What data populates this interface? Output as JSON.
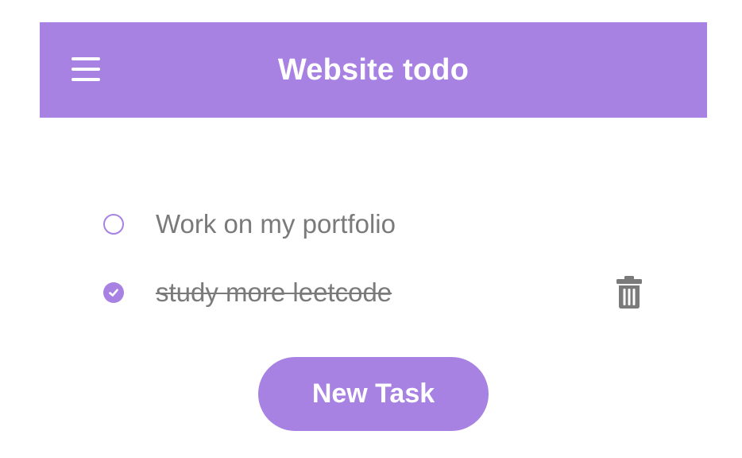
{
  "header": {
    "title": "Website todo",
    "menu_icon": "hamburger-menu-icon"
  },
  "tasks": [
    {
      "text": "Work on my portfolio",
      "completed": false
    },
    {
      "text": "study more leetcode",
      "completed": true,
      "action_icon": "trash-icon"
    }
  ],
  "new_task_button": {
    "label": "New Task"
  },
  "colors": {
    "accent": "#a782e3",
    "header_text": "#ffffff",
    "task_text": "#7a7a7a",
    "icon": "#7a7a7a"
  }
}
